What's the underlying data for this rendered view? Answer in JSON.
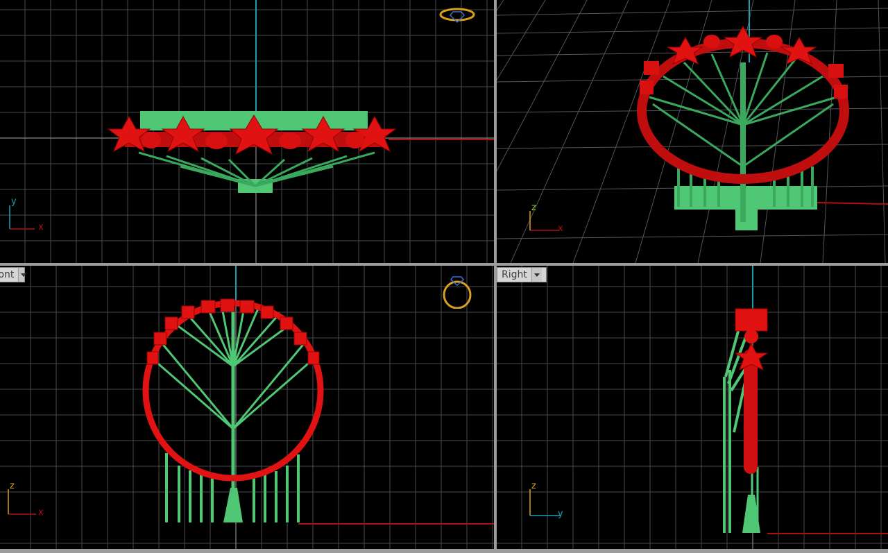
{
  "viewports": {
    "top": {
      "axis_labels": {
        "vertical": "y",
        "horizontal": "x"
      }
    },
    "perspective": {
      "axis_labels": {
        "vertical": "z",
        "horizontal": "x"
      }
    },
    "front": {
      "title": "Front",
      "axis_labels": {
        "vertical": "z",
        "horizontal": "x"
      }
    },
    "right": {
      "title": "Right",
      "axis_labels": {
        "vertical": "z",
        "horizontal": "y"
      }
    }
  },
  "colors": {
    "ring_red": "#e01212",
    "support_green": "#4fc774",
    "grid": "#5a5a5a",
    "axis_x": "#b01010",
    "axis_y": "#1a9fb0",
    "axis_z": "#d8a020",
    "background": "#000000"
  },
  "icons": [
    "ring-orientation-icon-top",
    "ring-orientation-icon-front"
  ]
}
